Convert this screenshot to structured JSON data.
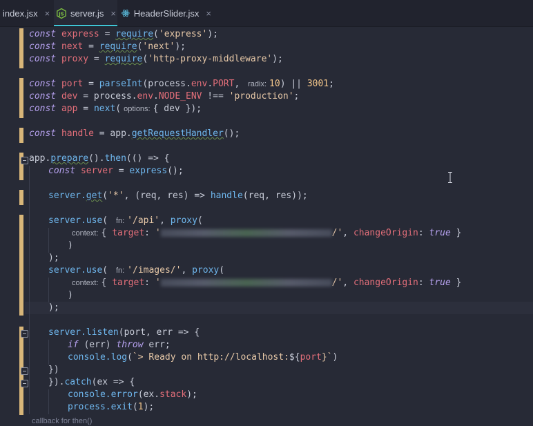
{
  "tabs": [
    {
      "label": "index.jsx",
      "close": "×",
      "icon": "jsx-file-icon"
    },
    {
      "label": "server.js",
      "close": "×",
      "icon": "nodejs-icon",
      "active": true
    },
    {
      "label": "HeaderSlider.jsx",
      "close": "×",
      "icon": "react-icon"
    }
  ],
  "colors": {
    "background": "#272a36",
    "tab_accent": "#3fc6d6",
    "gutter_change_marker": "#d8b679"
  },
  "code": {
    "l1": {
      "kw": "const",
      "name": "express",
      "op": " = ",
      "fn": "require",
      "a": "(",
      "s": "'express'",
      "b": ");"
    },
    "l2": {
      "kw": "const",
      "name": "next",
      "op": " = ",
      "fn": "require",
      "a": "(",
      "s": "'next'",
      "b": ");"
    },
    "l3": {
      "kw": "const",
      "name": "proxy",
      "op": " = ",
      "fn": "require",
      "a": "(",
      "s": "'http-proxy-middleware'",
      "b": ");"
    },
    "l5": {
      "kw": "const",
      "name": "port",
      "op": " = ",
      "fn": "parseInt",
      "a": "(process.",
      "p1": "env",
      "d": ".",
      "p2": "PORT",
      "c": ",",
      "hint": "radix:",
      "n1": "10",
      "e": ") || ",
      "n2": "3001",
      "f": ";"
    },
    "l6": {
      "kw": "const",
      "name": "dev",
      "op": " = process.",
      "p1": "env",
      "d": ".",
      "p2": "NODE_ENV",
      "e": " !== ",
      "s": "'production'",
      "f": ";"
    },
    "l7": {
      "kw": "const",
      "name": "app",
      "op": " = ",
      "fn": "next",
      "a": "(",
      "hint": "options:",
      "b": "{ dev });"
    },
    "l9": {
      "kw": "const",
      "name": "handle",
      "op": " = app.",
      "fn": "getRequestHandler",
      "b": "();"
    },
    "l11": {
      "a": "app.",
      "fn1": "prepare",
      "b": "().",
      "fn2": "then",
      "c": "(() => {"
    },
    "l12": {
      "kw": "const",
      "name": "server",
      "op": " = ",
      "fn": "express",
      "b": "();"
    },
    "l14": {
      "a": "server.",
      "fn": "get",
      "b": "(",
      "s": "'*'",
      "c": ", (req, res) => ",
      "fn2": "handle",
      "d": "(req, res));"
    },
    "l16": {
      "a": "server.",
      "fn": "use",
      "b": "(",
      "hint": "fn:",
      "s": "'/api'",
      "c": ", ",
      "fn2": "proxy",
      "d": "("
    },
    "l17": {
      "hint": "context:",
      "a": "{ ",
      "prop": "target",
      "b": ": ",
      "s1": "'",
      "s2": "/'",
      "c": ", ",
      "prop2": "changeOrigin",
      "d": ": ",
      "bool": "true",
      "e": " }"
    },
    "l18": {
      "a": ")"
    },
    "l19": {
      "a": ");"
    },
    "l20": {
      "a": "server.",
      "fn": "use",
      "b": "(",
      "hint": "fn:",
      "s": "'/images/'",
      "c": ", ",
      "fn2": "proxy",
      "d": "("
    },
    "l21": {
      "hint": "context:",
      "a": "{ ",
      "prop": "target",
      "b": ": ",
      "s1": "'",
      "s2": "/'",
      "c": ", ",
      "prop2": "changeOrigin",
      "d": ": ",
      "bool": "true",
      "e": " }"
    },
    "l22": {
      "a": ")"
    },
    "l23": {
      "a": ");"
    },
    "l25": {
      "a": "server.",
      "fn": "listen",
      "b": "(port, err => {"
    },
    "l26": {
      "kw1": "if",
      "a": " (err) ",
      "kw2": "throw",
      "b": " err;"
    },
    "l27": {
      "a": "console.",
      "fn": "log",
      "b": "(",
      "t": "`> Ready on http://localhost:",
      "t2": "${",
      "t3": "port",
      "t4": "}`",
      "c": ")"
    },
    "l28": {
      "a": "})"
    },
    "l29": {
      "a": "}).",
      "fn": "catch",
      "b": "(ex => {"
    },
    "l30": {
      "a": "console.",
      "fn": "error",
      "b": "(ex.",
      "prop": "stack",
      "c": ");"
    },
    "l31": {
      "a": "process.",
      "fn": "exit",
      "b": "(",
      "n": "1",
      "c": ");"
    }
  },
  "status_hint": "callback for then()"
}
